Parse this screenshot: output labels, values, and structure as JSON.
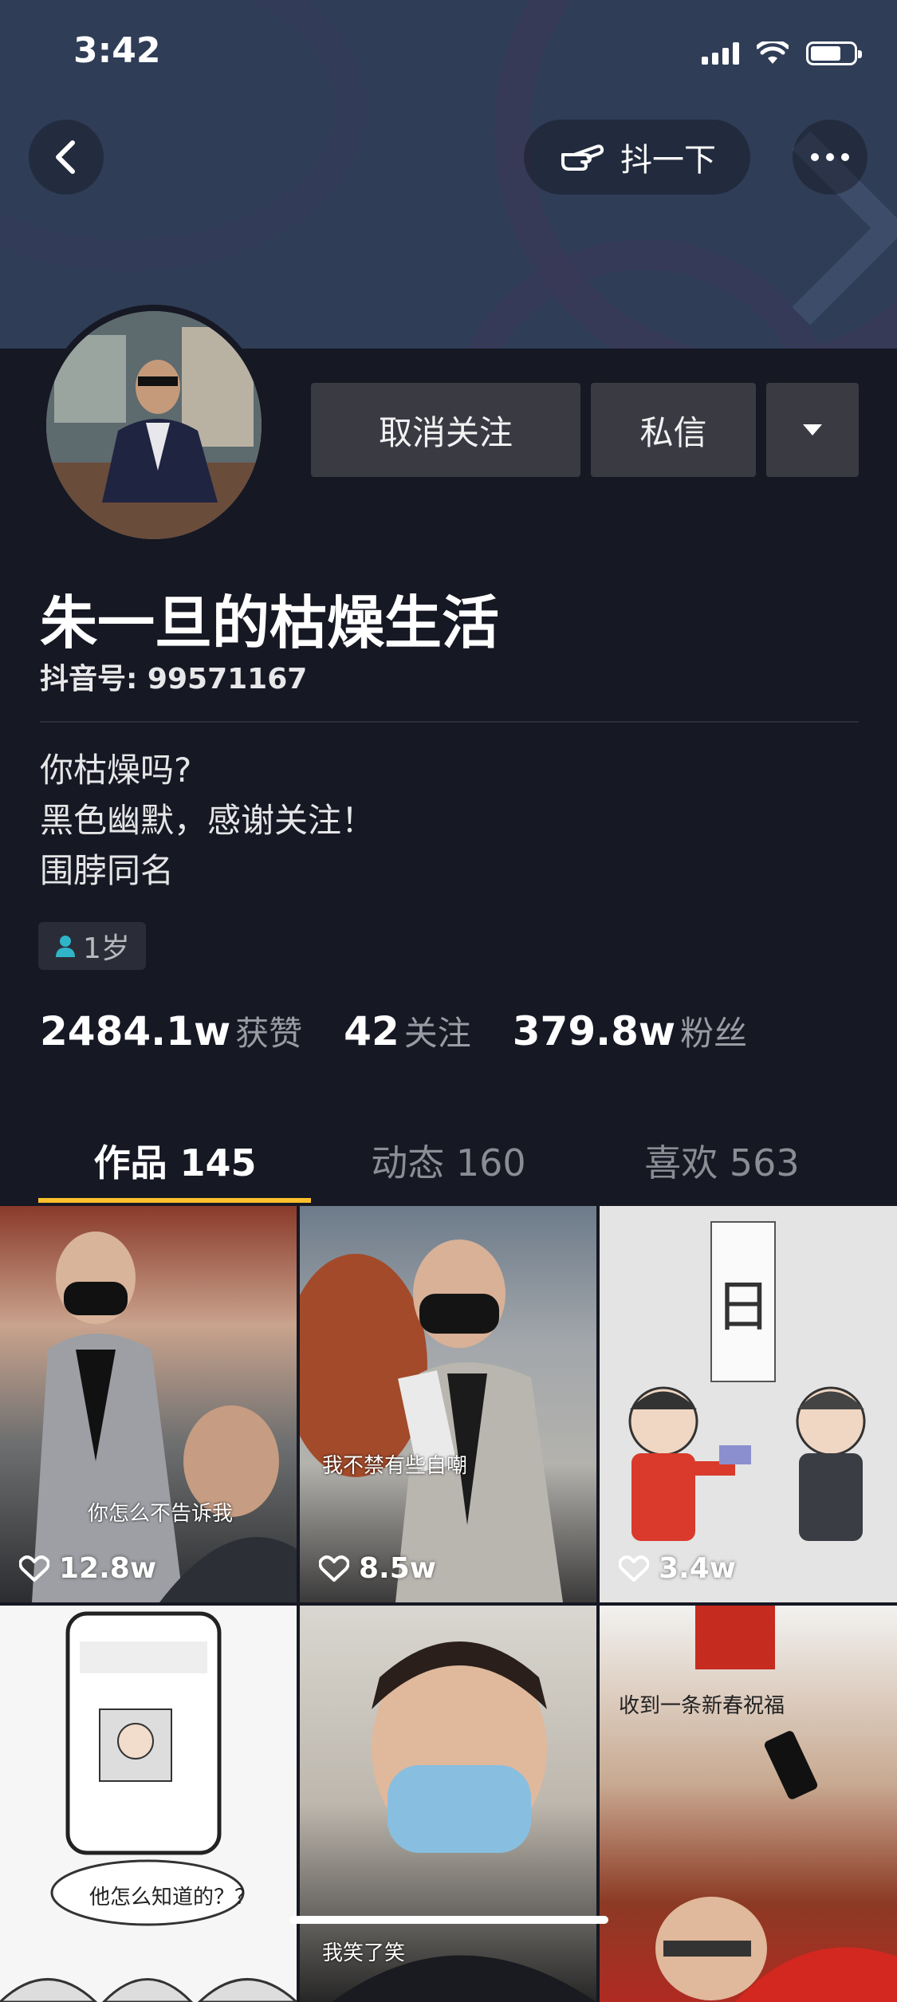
{
  "status_bar": {
    "time": "3:42"
  },
  "header": {
    "shake_label": "抖一下"
  },
  "profile": {
    "unfollow_label": "取消关注",
    "message_label": "私信",
    "name": "朱一旦的枯燥生活",
    "douyin_id": "抖音号: 99571167",
    "bio": [
      "你枯燥吗?",
      "黑色幽默，感谢关注！",
      "围脖同名"
    ],
    "age_tag": "1岁"
  },
  "stats": [
    {
      "value": "2484.1w",
      "label": "获赞"
    },
    {
      "value": "42",
      "label": "关注"
    },
    {
      "value": "379.8w",
      "label": "粉丝"
    }
  ],
  "tabs": [
    {
      "label": "作品 145"
    },
    {
      "label": "动态 160"
    },
    {
      "label": "喜欢 563"
    }
  ],
  "videos": [
    {
      "caption": "你怎么不告诉我",
      "likes": "12.8w"
    },
    {
      "caption": "我不禁有些自嘲",
      "likes": "8.5w"
    },
    {
      "caption": "",
      "likes": "3.4w"
    },
    {
      "caption": "他怎么知道的？？",
      "likes": ""
    },
    {
      "caption": "我笑了笑",
      "likes": ""
    },
    {
      "caption": "收到一条新春祝福",
      "likes": ""
    }
  ],
  "colors": {
    "accent": "#fcc02c",
    "background": "#161823",
    "button": "#3a3a43"
  }
}
